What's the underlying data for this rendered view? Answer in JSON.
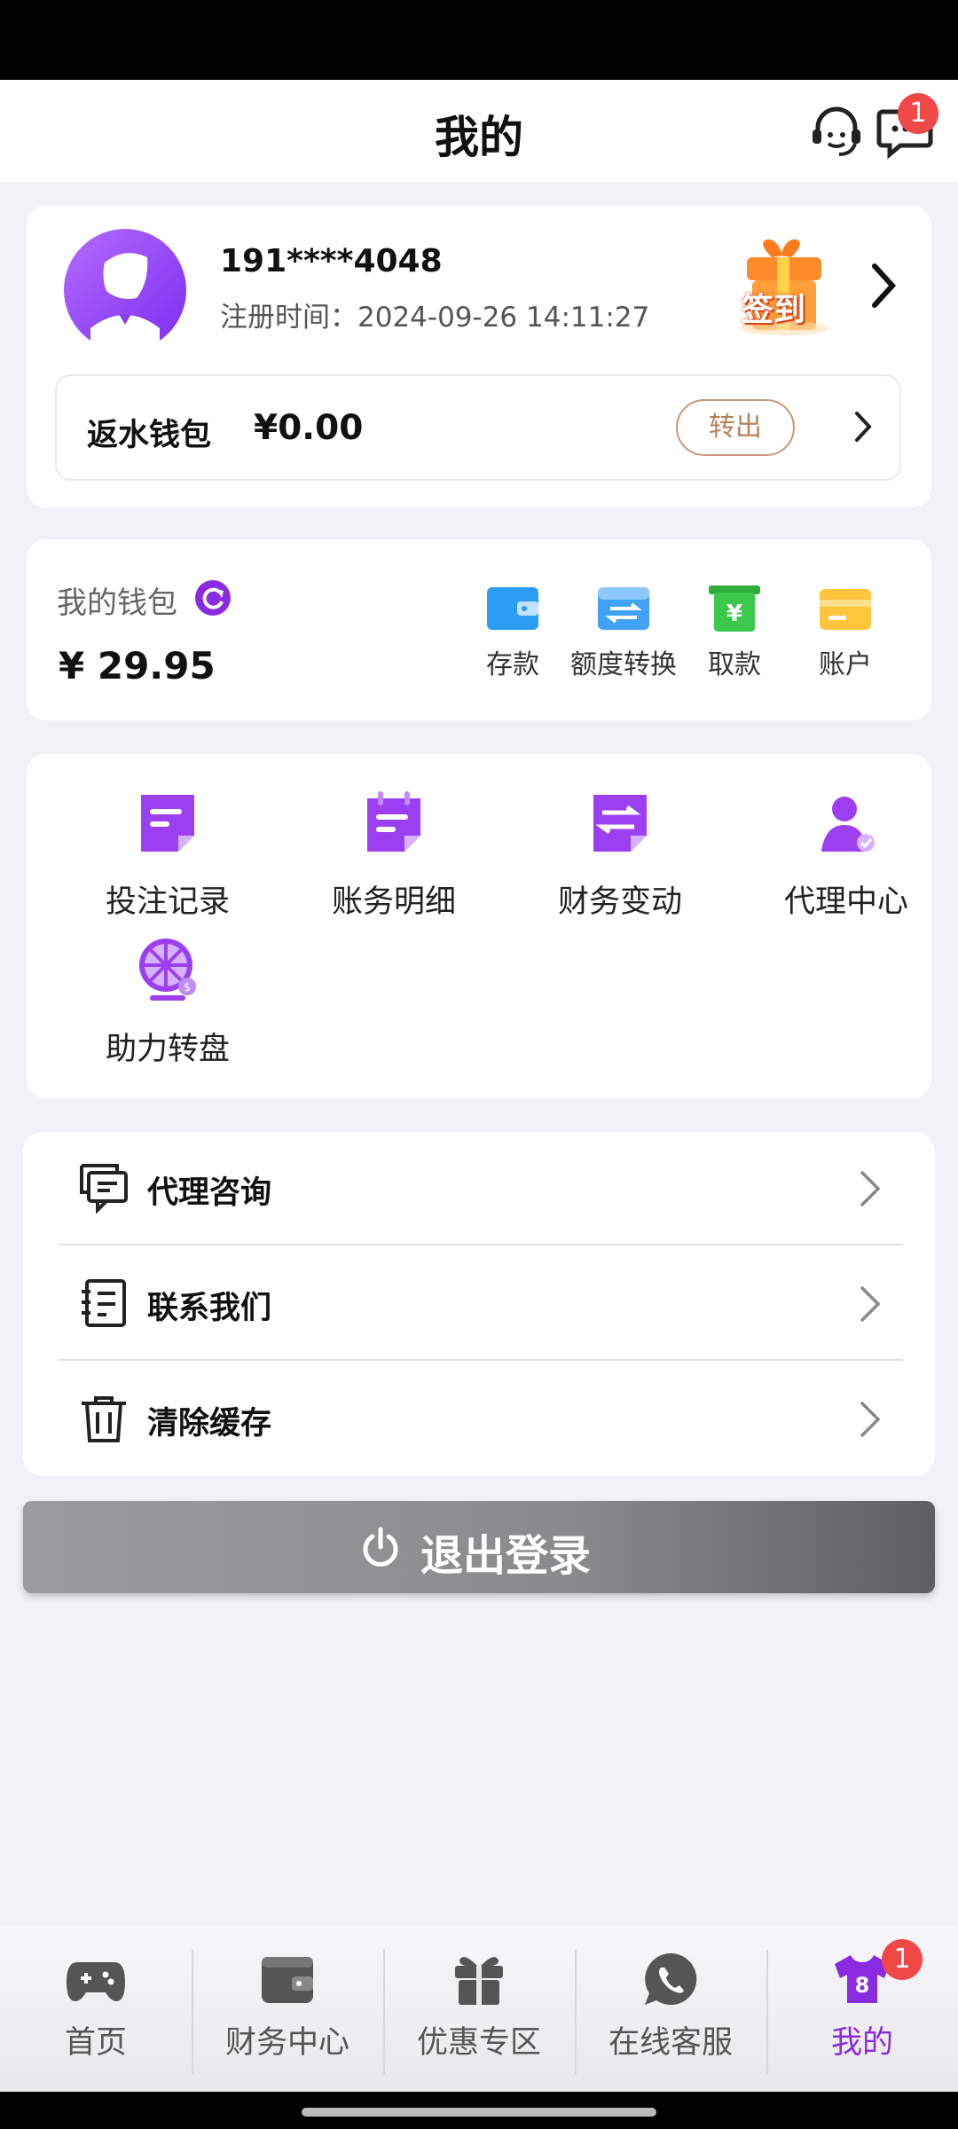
{
  "header": {
    "title": "我的",
    "message_badge": "1"
  },
  "profile": {
    "username": "191****4048",
    "reg_time": "注册时间：2024-09-26 14:11:27",
    "signin_label": "签到"
  },
  "rebate": {
    "label": "返水钱包",
    "amount": "¥0.00",
    "transfer_label": "转出"
  },
  "wallet": {
    "label": "我的钱包",
    "amount": "¥ 29.95",
    "actions": [
      {
        "label": "存款",
        "icon": "deposit-icon"
      },
      {
        "label": "额度转换",
        "icon": "transfer-icon"
      },
      {
        "label": "取款",
        "icon": "withdraw-icon"
      },
      {
        "label": "账户",
        "icon": "card-icon"
      }
    ]
  },
  "features": [
    {
      "label": "投注记录",
      "icon": "bet-record-icon"
    },
    {
      "label": "账务明细",
      "icon": "account-detail-icon"
    },
    {
      "label": "财务变动",
      "icon": "finance-change-icon"
    },
    {
      "label": "代理中心",
      "icon": "agent-center-icon"
    },
    {
      "label": "助力转盘",
      "icon": "lucky-wheel-icon"
    }
  ],
  "menu": [
    {
      "label": "代理咨询",
      "icon": "chat-list-icon"
    },
    {
      "label": "联系我们",
      "icon": "contact-book-icon"
    },
    {
      "label": "清除缓存",
      "icon": "trash-icon"
    }
  ],
  "logout": {
    "label": "退出登录"
  },
  "tabs": [
    {
      "label": "首页",
      "icon": "gamepad-icon"
    },
    {
      "label": "财务中心",
      "icon": "wallet-icon"
    },
    {
      "label": "优惠专区",
      "icon": "gift-icon"
    },
    {
      "label": "在线客服",
      "icon": "phone-chat-icon"
    },
    {
      "label": "我的",
      "icon": "shirt-icon",
      "badge": "1",
      "number": "8"
    }
  ],
  "colors": {
    "accent": "#8a2be2",
    "badge": "#f04848",
    "transfer_border": "#c59a7a"
  }
}
